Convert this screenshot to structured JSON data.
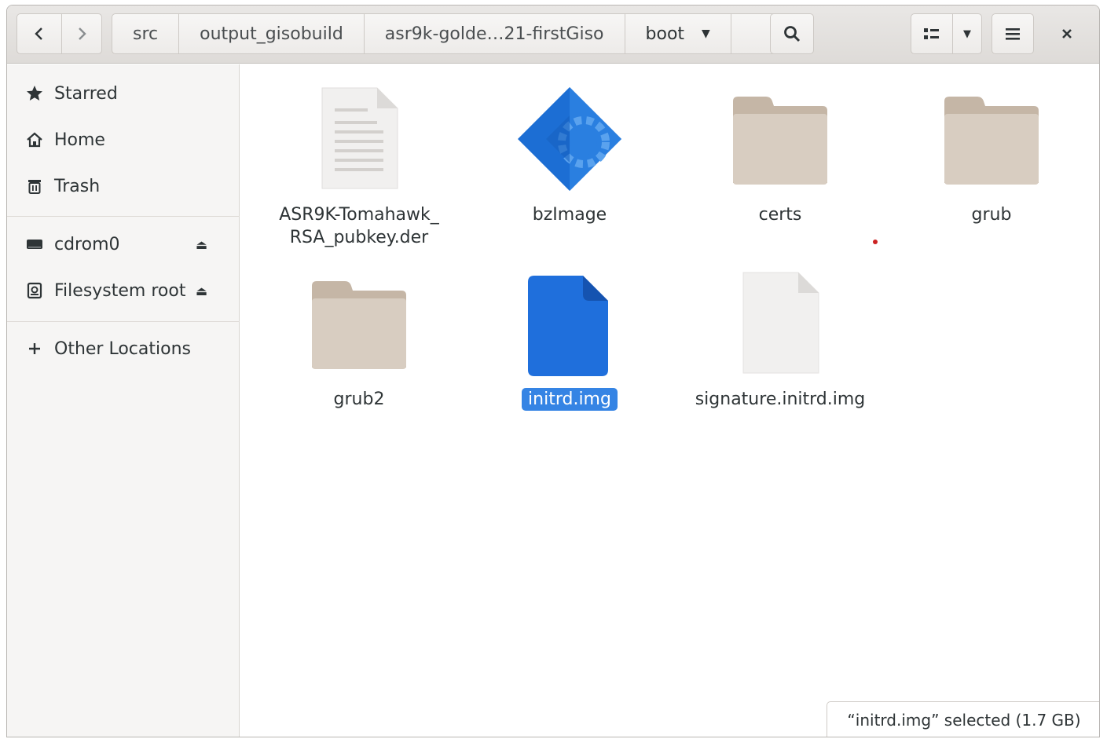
{
  "toolbar": {
    "back_icon": "chevron-left-icon",
    "forward_icon": "chevron-right-icon",
    "search_icon": "search-icon",
    "view_icon": "list-view-icon",
    "menu_icon": "hamburger-menu-icon",
    "close_icon": "close-icon"
  },
  "pathbar": {
    "crumbs": [
      "src",
      "output_gisobuild",
      "asr9k-golde…21-firstGiso",
      "boot"
    ]
  },
  "sidebar": {
    "items": [
      {
        "label": "Starred",
        "icon": "star-icon"
      },
      {
        "label": "Home",
        "icon": "home-icon"
      },
      {
        "label": "Trash",
        "icon": "trash-icon"
      },
      {
        "label": "cdrom0",
        "icon": "drive-icon"
      },
      {
        "label": "Filesystem root",
        "icon": "harddisk-icon"
      },
      {
        "label": "Other Locations",
        "icon": "plus-icon"
      }
    ]
  },
  "files": [
    {
      "name": "ASR9K-Tomahawk_\nRSA_pubkey.der",
      "type": "text-document"
    },
    {
      "name": "bzImage",
      "type": "executable"
    },
    {
      "name": "certs",
      "type": "folder"
    },
    {
      "name": "grub",
      "type": "folder"
    },
    {
      "name": "grub2",
      "type": "folder"
    },
    {
      "name": "initrd.img",
      "type": "disk-image",
      "selected": true
    },
    {
      "name": "signature.initrd.img",
      "type": "blank-document"
    }
  ],
  "status": {
    "text": "“initrd.img” selected  (1.7 GB)"
  },
  "colors": {
    "accent": "#3584e4",
    "folder": "#d8cdc1",
    "folder_tab": "#c5b6a6"
  }
}
